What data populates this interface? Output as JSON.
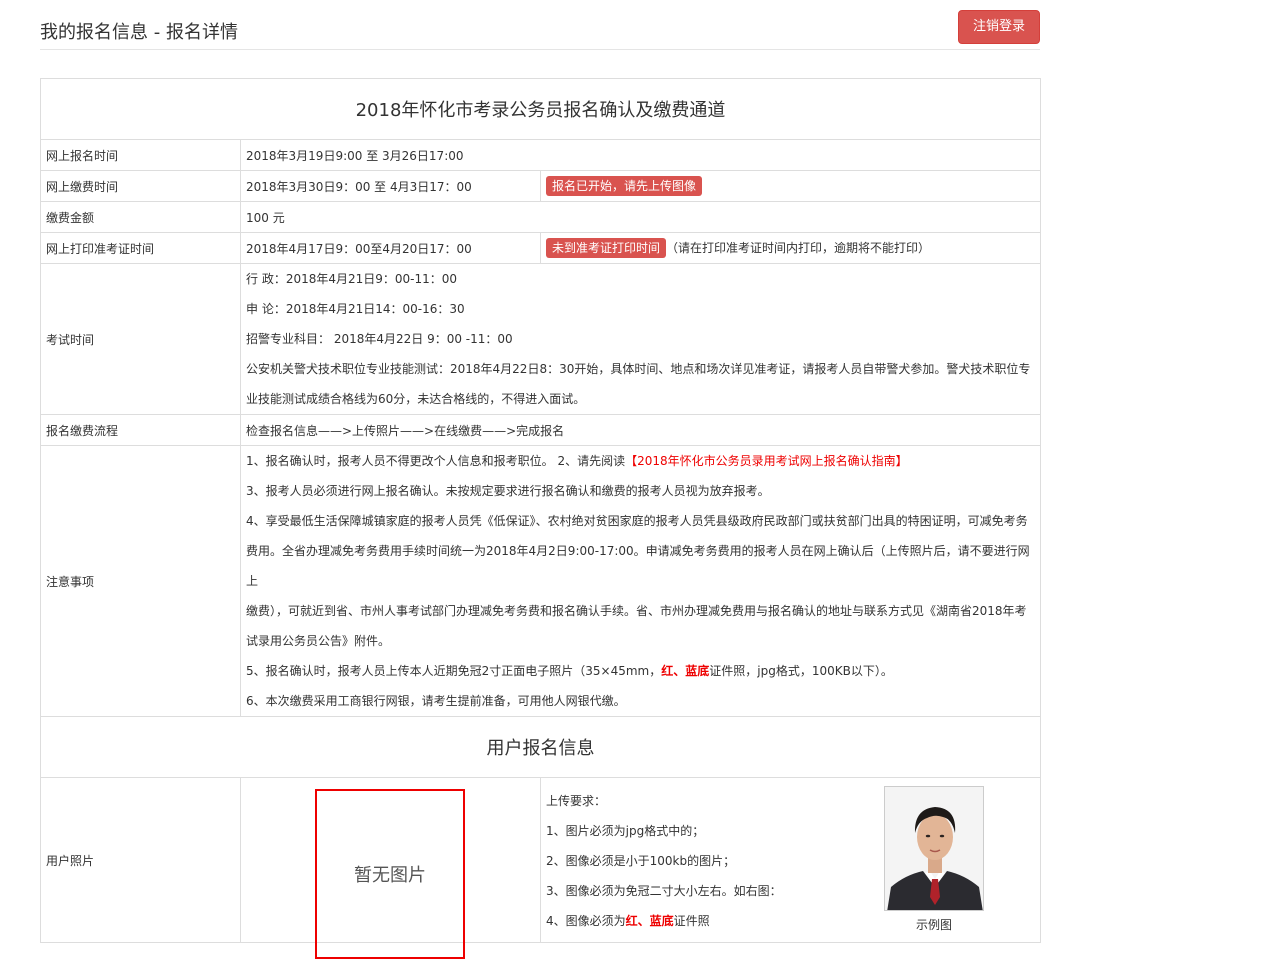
{
  "header": {
    "title": "我的报名信息 - 报名详情",
    "logout_label": "注销登录"
  },
  "table": {
    "title": "2018年怀化市考录公务员报名确认及缴费通道",
    "rows": {
      "reg_time_label": "网上报名时间",
      "reg_time_value": "2018年3月19日9:00 至 3月26日17:00",
      "pay_time_label": "网上缴费时间",
      "pay_time_value": "2018年3月30日9：00 至 4月3日17：00",
      "pay_badge": "报名已开始，请先上传图像",
      "amount_label": "缴费金额",
      "amount_value": "100 元",
      "print_label": "网上打印准考证时间",
      "print_value": "2018年4月17日9：00至4月20日17：00",
      "print_badge": "未到准考证打印时间",
      "print_note": "（请在打印准考证时间内打印，逾期将不能打印）",
      "exam_label": "考试时间",
      "exam_lines": [
        "行 政：2018年4月21日9：00-11：00",
        "申 论：2018年4月21日14：00-16：30",
        "招警专业科目： 2018年4月22日 9：00 -11：00",
        "公安机关警犬技术职位专业技能测试：2018年4月22日8：30开始，具体时间、地点和场次详见准考证，请报考人员自带警犬参加。警犬技术职位专",
        "业技能测试成绩合格线为60分，未达合格线的，不得进入面试。"
      ],
      "flow_label": "报名缴费流程",
      "flow_value": "检查报名信息——>上传照片——>在线缴费——>完成报名",
      "notice_label": "注意事项",
      "notice_1a": "1、报名确认时，报考人员不得更改个人信息和报考职位。 2、请先阅读",
      "notice_1_link": "【2018年怀化市公务员录用考试网上报名确认指南】",
      "notice_3": "3、报考人员必须进行网上报名确认。未按规定要求进行报名确认和缴费的报考人员视为放弃报考。",
      "notice_4_lines": [
        "4、享受最低生活保障城镇家庭的报考人员凭《低保证》、农村绝对贫困家庭的报考人员凭县级政府民政部门或扶贫部门出具的特困证明，可减免考务",
        "费用。全省办理减免考务费用手续时间统一为2018年4月2日9:00-17:00。申请减免考务费用的报考人员在网上确认后（上传照片后，请不要进行网上",
        "缴费），可就近到省、市州人事考试部门办理减免考务费和报名确认手续。省、市州办理减免费用与报名确认的地址与联系方式见《湖南省2018年考",
        "试录用公务员公告》附件。"
      ],
      "notice_5a": "5、报名确认时，报考人员上传本人近期免冠2寸正面电子照片（35×45mm，",
      "notice_5_red": "红、蓝底",
      "notice_5b": "证件照，jpg格式，100KB以下）。",
      "notice_6": "6、本次缴费采用工商银行网银，请考生提前准备，可用他人网银代缴。"
    },
    "user_section_title": "用户报名信息",
    "photo_label": "用户照片",
    "photo_placeholder": "暂无图片",
    "upload_req": {
      "title": "上传要求：",
      "line1": "1、图片必须为jpg格式中的；",
      "line2": "2、图像必须是小于100kb的图片；",
      "line3": "3、图像必须为免冠二寸大小左右。如右图：",
      "line4a": "4、图像必须为",
      "line4_red": "红、蓝底",
      "line4b": "证件照"
    },
    "sample_caption": "示例图"
  }
}
